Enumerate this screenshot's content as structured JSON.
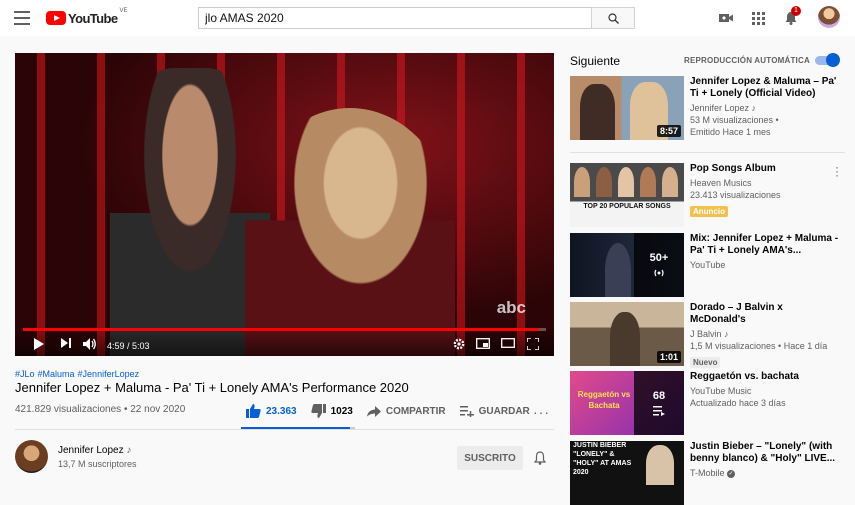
{
  "topbar": {
    "logo_text": "YouTube",
    "country_code": "VE",
    "search_value": "jlo AMAS 2020",
    "notifications_count": "1"
  },
  "player": {
    "watermark": "abc",
    "time_current": "4:59",
    "time_sep": " / ",
    "time_total": "5:03",
    "progress": 0.987
  },
  "video": {
    "hashtags": [
      "#JLo",
      "#Maluma",
      "#JenniferLopez"
    ],
    "title": "Jennifer Lopez + Maluma - Pa' Ti + Lonely AMA's Performance 2020",
    "views": "421.829 visualizaciones",
    "meta_sep": " • ",
    "date": "22 nov 2020",
    "likes": "23.363",
    "dislikes": "1023",
    "share_label": "COMPARTIR",
    "save_label": "GUARDAR",
    "like_ratio": 0.958
  },
  "channel": {
    "name": "Jennifer Lopez",
    "subscribers": "13,7 M suscriptores",
    "subscribe_label": "SUSCRITO"
  },
  "sidebar": {
    "heading": "Siguiente",
    "autoplay_label": "REPRODUCCIÓN AUTOMÁTICA",
    "autoplay_on": true,
    "items": [
      {
        "title": "Jennifer Lopez & Maluma – Pa' Ti + Lonely (Official Video)",
        "channel": "Jennifer Lopez ♪",
        "views": "53 M visualizaciones •",
        "extra": "Emitido Hace 1 mes",
        "duration": "8:57"
      },
      {
        "title": "Pop Songs Album",
        "channel": "Heaven Musics",
        "views": "23.413 visualizaciones",
        "badge": "Anuncio",
        "thumb_text": "TOP 20 POPULAR SONGS"
      },
      {
        "title": "Mix: Jennifer Lopez + Maluma - Pa' Ti + Lonely AMA's...",
        "channel": "YouTube",
        "overlay_count": "50+"
      },
      {
        "title": "Dorado – J Balvin x McDonald's",
        "channel": "J Balvin ♪",
        "views": "1,5 M visualizaciones • Hace 1 día",
        "badge": "Nuevo",
        "duration": "1:01"
      },
      {
        "title": "Reggaetón vs. bachata",
        "channel": "YouTube Music",
        "views": "Actualizado hace 3 días",
        "overlay_count": "68",
        "thumb_text": "Reggaetón vs Bachata"
      },
      {
        "title": "Justin Bieber – \"Lonely\" (with benny blanco) & \"Holy\" LIVE...",
        "channel": "T-Mobile",
        "thumb_text": "JUSTIN BIEBER \"LONELY\" & \"HOLY\" AT AMAS 2020"
      }
    ]
  }
}
